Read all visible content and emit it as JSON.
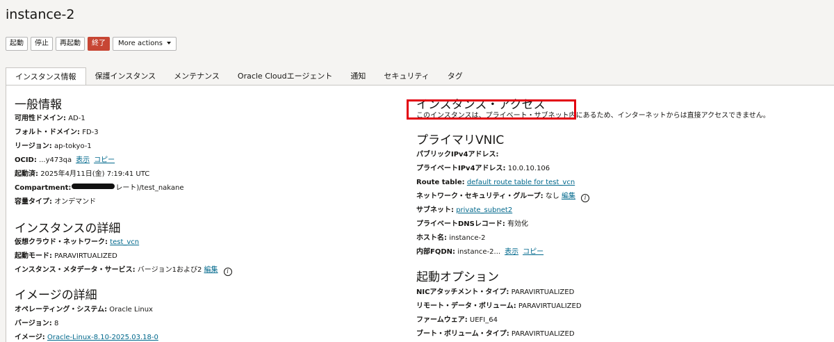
{
  "title": "instance-2",
  "buttons": {
    "start": "起動",
    "stop": "停止",
    "reboot": "再起動",
    "terminate": "終了",
    "more": "More actions"
  },
  "tabs": [
    "インスタンス情報",
    "保護インスタンス",
    "メンテナンス",
    "Oracle Cloudエージェント",
    "通知",
    "セキュリティ",
    "タグ"
  ],
  "general": {
    "heading": "一般情報",
    "ad_label": "可用性ドメイン:",
    "ad_value": "AD-1",
    "fd_label": "フォルト・ドメイン:",
    "fd_value": "FD-3",
    "region_label": "リージョン:",
    "region_value": "ap-tokyo-1",
    "ocid_label": "OCID:",
    "ocid_value": "...y473qa",
    "show": "表示",
    "copy": "コピー",
    "launched_label": "起動済:",
    "launched_value": "2025年4月11日(金) 7:19:41 UTC",
    "compartment_label": "Compartment:",
    "compartment_value": "レート)/test_nakane",
    "capacity_label": "容量タイプ:",
    "capacity_value": "オンデマンド"
  },
  "instance_details": {
    "heading": "インスタンスの詳細",
    "vcn_label": "仮想クラウド・ネットワーク:",
    "vcn_value": "test_vcn",
    "launch_mode_label": "起動モード:",
    "launch_mode_value": "PARAVIRTUALIZED",
    "metadata_label": "インスタンス・メタデータ・サービス:",
    "metadata_value": "バージョン1および2",
    "edit": "編集"
  },
  "image_details": {
    "heading": "イメージの詳細",
    "os_label": "オペレーティング・システム:",
    "os_value": "Oracle Linux",
    "version_label": "バージョン:",
    "version_value": "8",
    "image_label": "イメージ:",
    "image_value": "Oracle-Linux-8.10-2025.03.18-0"
  },
  "access": {
    "heading": "インスタンス・アクセス",
    "note": "このインスタンスは、プライベート・サブネット内にあるため、インターネットからは直接アクセスできません。"
  },
  "vnic": {
    "heading": "プライマリVNIC",
    "public_ip_label": "パブリックIPv4アドレス:",
    "private_ip_label": "プライベートIPv4アドレス:",
    "private_ip_value": "10.0.10.106",
    "route_label": "Route table:",
    "route_value": "default route table for test_vcn",
    "nsg_label": "ネットワーク・セキュリティ・グループ:",
    "nsg_value": "なし",
    "edit": "編集",
    "subnet_label": "サブネット:",
    "subnet_value": "private_subnet2",
    "dns_label": "プライベートDNSレコード:",
    "dns_value": "有効化",
    "host_label": "ホスト名:",
    "host_value": "instance-2",
    "fqdn_label": "内部FQDN:",
    "fqdn_value": "instance-2...",
    "show": "表示",
    "copy": "コピー"
  },
  "launch_options": {
    "heading": "起動オプション",
    "nic_label": "NICアタッチメント・タイプ:",
    "nic_value": "PARAVIRTUALIZED",
    "remote_label": "リモート・データ・ボリューム:",
    "remote_value": "PARAVIRTUALIZED",
    "firmware_label": "ファームウェア:",
    "firmware_value": "UEFI_64",
    "boot_label": "ブート・ボリューム・タイプ:",
    "boot_value": "PARAVIRTUALIZED"
  }
}
